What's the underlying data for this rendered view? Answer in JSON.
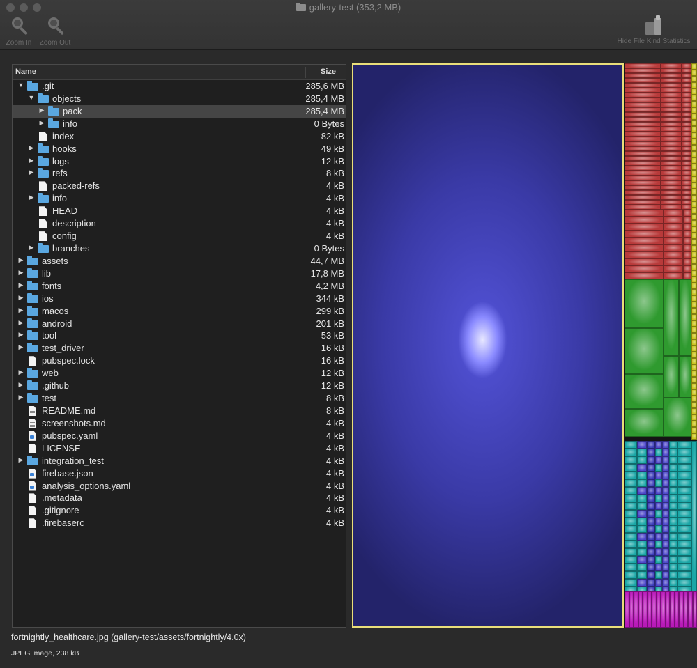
{
  "window": {
    "title": "gallery-test (353,2 MB)"
  },
  "toolbar": {
    "zoom_in_label": "Zoom In",
    "zoom_out_label": "Zoom Out",
    "hide_stats_label": "Hide File Kind Statistics"
  },
  "tree": {
    "header_name": "Name",
    "header_size": "Size",
    "rows": [
      {
        "name": ".git",
        "size": "285,6 MB",
        "depth": 0,
        "kind": "folder",
        "expanded": true
      },
      {
        "name": "objects",
        "size": "285,4 MB",
        "depth": 1,
        "kind": "folder",
        "expanded": true
      },
      {
        "name": "pack",
        "size": "285,4 MB",
        "depth": 2,
        "kind": "folder",
        "expanded": false,
        "selected": true
      },
      {
        "name": "info",
        "size": "0 Bytes",
        "depth": 2,
        "kind": "folder",
        "expanded": false
      },
      {
        "name": "index",
        "size": "82 kB",
        "depth": 1,
        "kind": "file"
      },
      {
        "name": "hooks",
        "size": "49 kB",
        "depth": 1,
        "kind": "folder",
        "expanded": false
      },
      {
        "name": "logs",
        "size": "12 kB",
        "depth": 1,
        "kind": "folder",
        "expanded": false
      },
      {
        "name": "refs",
        "size": "8 kB",
        "depth": 1,
        "kind": "folder",
        "expanded": false
      },
      {
        "name": "packed-refs",
        "size": "4 kB",
        "depth": 1,
        "kind": "file"
      },
      {
        "name": "info",
        "size": "4 kB",
        "depth": 1,
        "kind": "folder",
        "expanded": false
      },
      {
        "name": "HEAD",
        "size": "4 kB",
        "depth": 1,
        "kind": "file"
      },
      {
        "name": "description",
        "size": "4 kB",
        "depth": 1,
        "kind": "file"
      },
      {
        "name": "config",
        "size": "4 kB",
        "depth": 1,
        "kind": "file"
      },
      {
        "name": "branches",
        "size": "0 Bytes",
        "depth": 1,
        "kind": "folder",
        "expanded": false
      },
      {
        "name": "assets",
        "size": "44,7 MB",
        "depth": 0,
        "kind": "folder",
        "expanded": false
      },
      {
        "name": "lib",
        "size": "17,8 MB",
        "depth": 0,
        "kind": "folder",
        "expanded": false
      },
      {
        "name": "fonts",
        "size": "4,2 MB",
        "depth": 0,
        "kind": "folder",
        "expanded": false
      },
      {
        "name": "ios",
        "size": "344 kB",
        "depth": 0,
        "kind": "folder",
        "expanded": false
      },
      {
        "name": "macos",
        "size": "299 kB",
        "depth": 0,
        "kind": "folder",
        "expanded": false
      },
      {
        "name": "android",
        "size": "201 kB",
        "depth": 0,
        "kind": "folder",
        "expanded": false
      },
      {
        "name": "tool",
        "size": "53 kB",
        "depth": 0,
        "kind": "folder",
        "expanded": false
      },
      {
        "name": "test_driver",
        "size": "16 kB",
        "depth": 0,
        "kind": "folder",
        "expanded": false
      },
      {
        "name": "pubspec.lock",
        "size": "16 kB",
        "depth": 0,
        "kind": "file"
      },
      {
        "name": "web",
        "size": "12 kB",
        "depth": 0,
        "kind": "folder",
        "expanded": false
      },
      {
        "name": ".github",
        "size": "12 kB",
        "depth": 0,
        "kind": "folder",
        "expanded": false
      },
      {
        "name": "test",
        "size": "8 kB",
        "depth": 0,
        "kind": "folder",
        "expanded": false
      },
      {
        "name": "README.md",
        "size": "8 kB",
        "depth": 0,
        "kind": "text"
      },
      {
        "name": "screenshots.md",
        "size": "4 kB",
        "depth": 0,
        "kind": "text"
      },
      {
        "name": "pubspec.yaml",
        "size": "4 kB",
        "depth": 0,
        "kind": "code"
      },
      {
        "name": "LICENSE",
        "size": "4 kB",
        "depth": 0,
        "kind": "file"
      },
      {
        "name": "integration_test",
        "size": "4 kB",
        "depth": 0,
        "kind": "folder",
        "expanded": false
      },
      {
        "name": "firebase.json",
        "size": "4 kB",
        "depth": 0,
        "kind": "code"
      },
      {
        "name": "analysis_options.yaml",
        "size": "4 kB",
        "depth": 0,
        "kind": "code"
      },
      {
        "name": ".metadata",
        "size": "4 kB",
        "depth": 0,
        "kind": "file"
      },
      {
        "name": ".gitignore",
        "size": "4 kB",
        "depth": 0,
        "kind": "file"
      },
      {
        "name": ".firebaserc",
        "size": "4 kB",
        "depth": 0,
        "kind": "file"
      }
    ]
  },
  "treemap": {
    "selected_color": "#3a3aa6",
    "highlight_border": "#e9de7a",
    "group_colors": {
      "red": "#b83a3a",
      "green": "#2f9a2f",
      "cyan": "#1aa6a6",
      "magenta": "#b81ab8",
      "yellow": "#c9c21a"
    }
  },
  "status": {
    "path": "fortnightly_healthcare.jpg (gallery-test/assets/fortnightly/4.0x)",
    "kind": "JPEG image, 238 kB"
  }
}
